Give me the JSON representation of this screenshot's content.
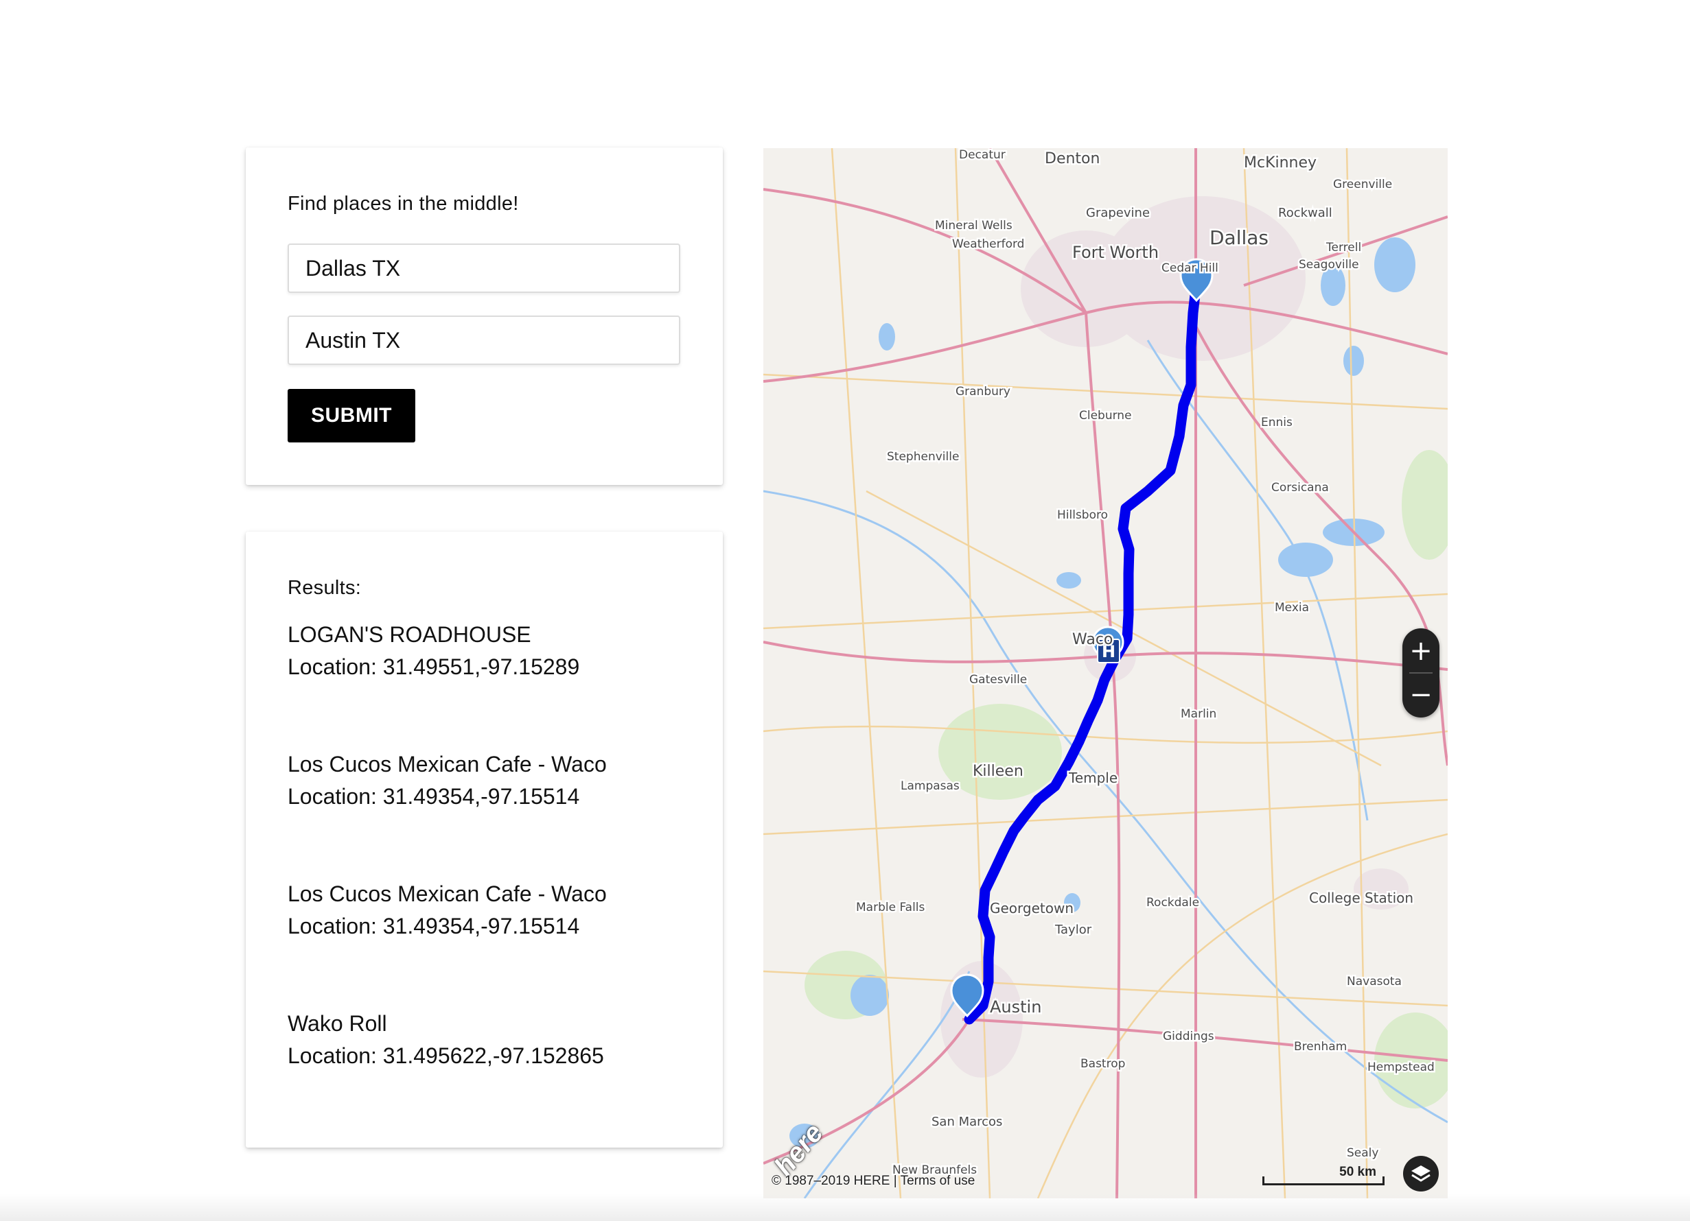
{
  "search": {
    "title": "Find places in the middle!",
    "from_value": "Dallas TX",
    "to_value": "Austin TX",
    "submit_label": "SUBMIT"
  },
  "results": {
    "title": "Results:",
    "items": [
      {
        "name": "LOGAN'S ROADHOUSE",
        "location": "Location: 31.49551,-97.15289"
      },
      {
        "name": "Los Cucos Mexican Cafe - Waco",
        "location": "Location: 31.49354,-97.15514"
      },
      {
        "name": "Los Cucos Mexican Cafe - Waco",
        "location": "Location: 31.49354,-97.15514"
      },
      {
        "name": "Wako Roll",
        "location": "Location: 31.495622,-97.152865"
      }
    ]
  },
  "map": {
    "cities": [
      "Decatur",
      "Denton",
      "McKinney",
      "Greenville",
      "Rockwall",
      "Grapevine",
      "Mineral Wells",
      "Fort Worth",
      "Dallas",
      "Weatherford",
      "Terrell",
      "Seagoville",
      "Cedar Hill",
      "Granbury",
      "Cleburne",
      "Ennis",
      "Stephenville",
      "Corsicana",
      "Hillsboro",
      "Mexia",
      "Waco",
      "Gatesville",
      "Marlin",
      "Killeen",
      "Temple",
      "Lampasas",
      "Georgetown",
      "Rockdale",
      "College Station",
      "Marble Falls",
      "Taylor",
      "Navasota",
      "Austin",
      "Giddings",
      "Brenham",
      "Bastrop",
      "Hempstead",
      "San Marcos",
      "Sealy",
      "New Braunfels"
    ],
    "zoom_in_label": "+",
    "zoom_out_label": "−",
    "copyright": "© 1987–2019 HERE | ",
    "terms_label": "Terms of use",
    "scale_label": "50 km",
    "logo_text": "here",
    "route_color": "#0000ee",
    "marker_color": "#4a90d9"
  }
}
